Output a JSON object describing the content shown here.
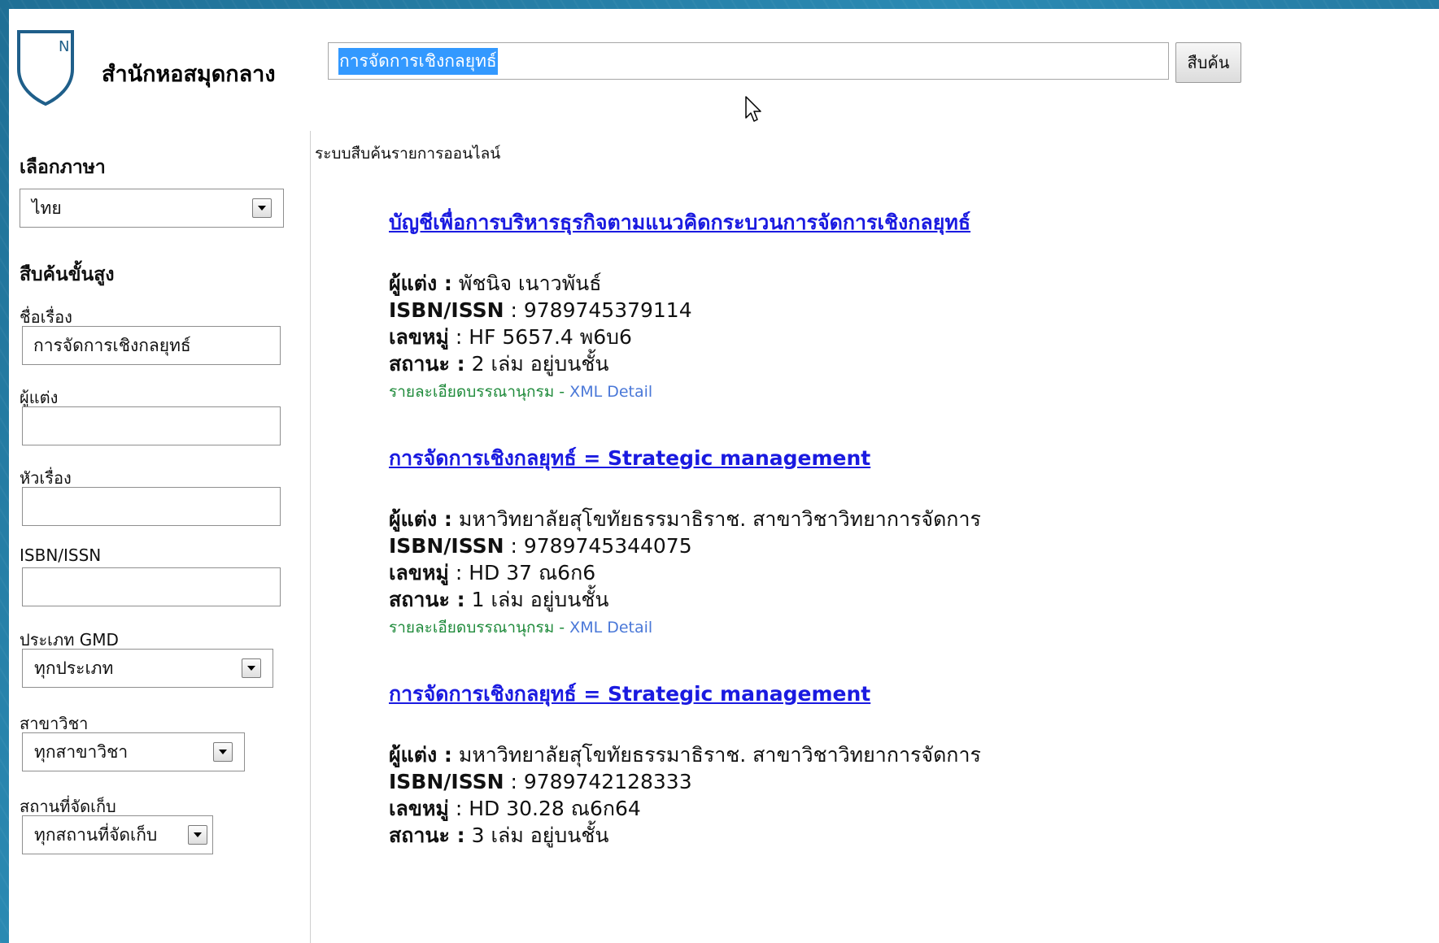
{
  "header": {
    "site_title": "สำนักหอสมุดกลาง",
    "search_value": "การจัดการเชิงกลยุทธ์",
    "search_button": "สืบค้น",
    "logo_letter": "N"
  },
  "sidebar": {
    "language_heading": "เลือกภาษา",
    "language_value": "ไทย",
    "advanced_heading": "สืบค้นขั้นสูง",
    "title_label": "ชื่อเรื่อง",
    "title_value": "การจัดการเชิงกลยุทธ์",
    "author_label": "ผู้แต่ง",
    "author_value": "",
    "subject_label": "หัวเรื่อง",
    "subject_value": "",
    "isbn_label": "ISBN/ISSN",
    "isbn_value": "",
    "gmd_label": "ประเภท GMD",
    "gmd_value": "ทุกประเภท",
    "branch_label": "สาขาวิชา",
    "branch_value": "ทุกสาขาวิชา",
    "location_label": "สถานที่จัดเก็บ",
    "location_value": "ทุกสถานที่จัดเก็บ"
  },
  "main": {
    "heading": "ระบบสืบค้นรายการออนไลน์",
    "field_labels": {
      "author": "ผู้แต่ง :",
      "isbn": "ISBN/ISSN",
      "callno": "เลขหมู่",
      "status": "สถานะ :"
    },
    "links": {
      "bib": "รายละเอียดบรรณานุกรม",
      "sep": " - ",
      "xml": "XML Detail"
    },
    "results": [
      {
        "title": "บัญชีเพื่อการบริหารธุรกิจตามแนวคิดกระบวนการจัดการเชิงกลยุทธ์",
        "author": " พัชนิจ เนาวพันธ์",
        "isbn": " : 9789745379114",
        "callno": " : HF 5657.4 พ6บ6",
        "status": " 2 เล่ม อยู่บนชั้น"
      },
      {
        "title": "การจัดการเชิงกลยุทธ์ = Strategic management",
        "author": " มหาวิทยาลัยสุโขทัยธรรมาธิราช. สาขาวิชาวิทยาการจัดการ",
        "isbn": " : 9789745344075",
        "callno": " : HD 37 ณ6ก6",
        "status": " 1 เล่ม อยู่บนชั้น"
      },
      {
        "title": "การจัดการเชิงกลยุทธ์ = Strategic management",
        "author": " มหาวิทยาลัยสุโขทัยธรรมาธิราช. สาขาวิชาวิทยาการจัดการ",
        "isbn": " : 9789742128333",
        "callno": " : HD 30.28 ณ6ก64",
        "status": " 3 เล่ม อยู่บนชั้น"
      }
    ]
  },
  "colors": {
    "link_title": "#1a1ae0",
    "bib_link": "#1e8a3a",
    "xml_link": "#4a78d8",
    "selection": "#3399ff",
    "shield": "#1f5f8a"
  }
}
